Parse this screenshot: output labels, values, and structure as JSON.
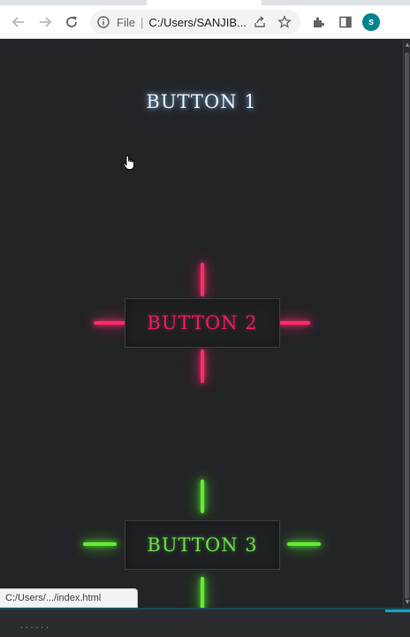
{
  "browser": {
    "address_scheme": "File",
    "address_separator": "|",
    "address_url": "C:/Users/SANJIB...",
    "profile_initial": "s",
    "status_url": "C:/Users/.../index.html"
  },
  "page": {
    "buttons": [
      {
        "label": "BUTTON 1",
        "color": "#e8f3ff"
      },
      {
        "label": "BUTTON 2",
        "color": "#e91e63"
      },
      {
        "label": "BUTTON 3",
        "color": "#6fdc4a"
      }
    ]
  },
  "taskbar": {
    "indicator": "......"
  },
  "colors": {
    "page_background": "#232427",
    "neon_pink": "#ff2b6b",
    "neon_green": "#5cf02f",
    "profile_avatar": "#00838f"
  },
  "icons": [
    "back-icon",
    "forward-icon",
    "reload-icon",
    "info-icon",
    "share-icon",
    "star-icon",
    "extensions-icon",
    "side-panel-icon",
    "mouse-pointer-icon"
  ]
}
